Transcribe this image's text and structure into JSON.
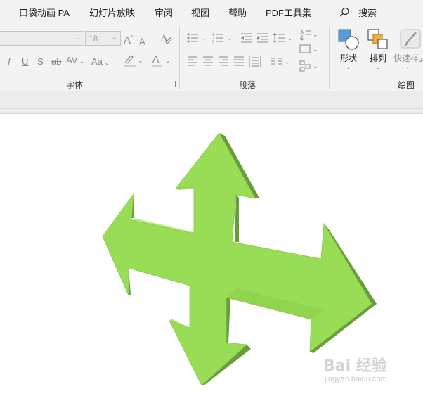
{
  "menu": {
    "items": [
      "口袋动画 PA",
      "幻灯片放映",
      "审阅",
      "视图",
      "帮助",
      "PDF工具集",
      "搜索"
    ]
  },
  "ribbon": {
    "font": {
      "font_size_value": "18",
      "group_label": "字体",
      "char_spacing_label": "AV",
      "change_case_label": "Aa"
    },
    "paragraph": {
      "group_label": "段落"
    },
    "drawing": {
      "shape_label": "形状",
      "arrange_label": "排列",
      "quick_styles_label": "快速样式",
      "group_label": "绘图"
    }
  },
  "slide": {
    "shape_name": "four-way-arrow",
    "fill_color": "#99dd57",
    "side_dark": "#6a9c3a",
    "side_light": "#b6ea80"
  },
  "watermark": {
    "brand": "Bai 经验",
    "url": "jingyan.baidu.com"
  },
  "colors": {
    "ribbon_bg": "#f3f3f3",
    "accent_blue": "#5b9bd5",
    "accent_orange": "#f0b040"
  }
}
